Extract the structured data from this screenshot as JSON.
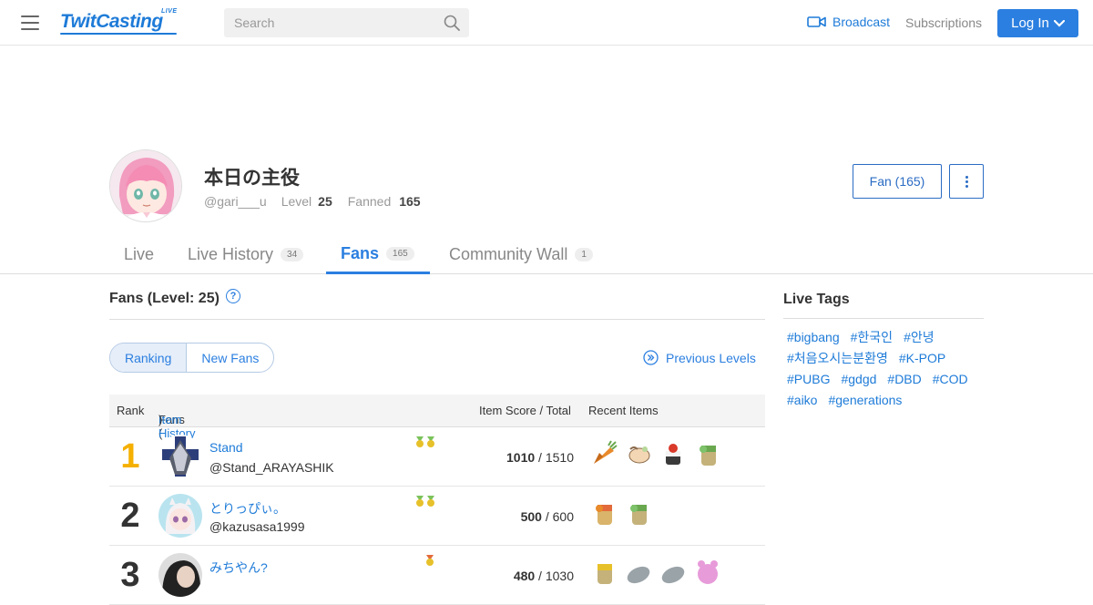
{
  "header": {
    "logo_text": "TwitCasting",
    "logo_badge": "LIVE",
    "search_placeholder": "Search",
    "broadcast_label": "Broadcast",
    "subscriptions_label": "Subscriptions",
    "login_label": "Log In"
  },
  "profile": {
    "name": "本日の主役",
    "handle": "@gari___u",
    "level_label": "Level",
    "level_value": "25",
    "fanned_label": "Fanned",
    "fanned_value": "165",
    "fan_button": "Fan (165)"
  },
  "tabs": [
    {
      "label": "Live",
      "count": ""
    },
    {
      "label": "Live History",
      "count": "34"
    },
    {
      "label": "Fans",
      "count": "165"
    },
    {
      "label": "Community Wall",
      "count": "1"
    }
  ],
  "fans_section": {
    "title": "Fans (Level: 25)",
    "help": "?",
    "segments": [
      "Ranking",
      "New Fans"
    ],
    "previous_levels": "Previous Levels"
  },
  "table": {
    "headers": {
      "rank": "Rank",
      "fans_prefix": "Fans (",
      "item_history": "Item History",
      "fans_suffix": ")",
      "score": "Item Score / Total",
      "recent": "Recent Items"
    },
    "rows": [
      {
        "rank": "1",
        "name": "Stand",
        "handle": "@Stand_ARAYASHIK",
        "score": "1010",
        "total": " / 1510"
      },
      {
        "rank": "2",
        "name": "とりっぴぃ。",
        "handle": "@kazusasa1999",
        "score": "500",
        "total": " / 600"
      },
      {
        "rank": "3",
        "name": "みちやん?",
        "handle": "",
        "score": "480",
        "total": " / 1030"
      }
    ]
  },
  "live_tags": {
    "title": "Live Tags",
    "tags": [
      "#bigbang",
      "#한국인",
      "#안녕",
      "#처음오시는분환영",
      "#K-POP",
      "#PUBG",
      "#gdgd",
      "#DBD",
      "#COD",
      "#aiko",
      "#generations"
    ]
  },
  "colors": {
    "accent": "#2b7fe0",
    "link": "#1e7bd8",
    "gold_rank": "#f5b000"
  }
}
